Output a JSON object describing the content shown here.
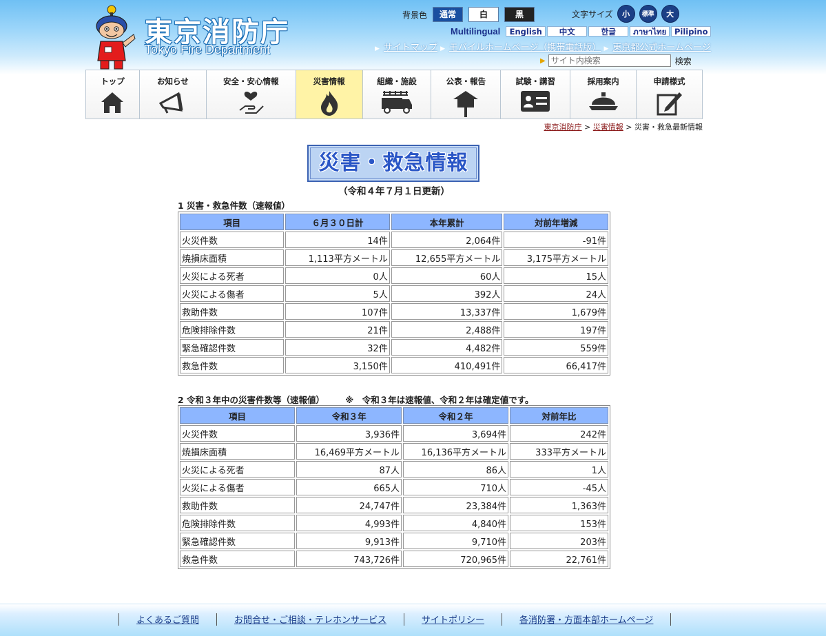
{
  "header": {
    "logo_jp": "東京消防庁",
    "logo_en": "Tokyo Fire Department",
    "bg_label": "背景色",
    "bg_options": [
      "通常",
      "白",
      "黒"
    ],
    "font_label": "文字サイズ",
    "font_options": [
      "小",
      "標準",
      "大"
    ],
    "multilingual_label": "Multilingual",
    "languages": [
      "English",
      "中文",
      "한글",
      "ภาษาไทย",
      "Pilipino"
    ],
    "links": [
      "サイトマップ",
      "モバイルホームページ（携帯電話版）",
      "東京都公式ホームページ"
    ],
    "search_placeholder": "サイト内検索",
    "search_button": "検索"
  },
  "nav": [
    {
      "label": "トップ",
      "icon": "house-icon"
    },
    {
      "label": "お知らせ",
      "icon": "megaphone-icon"
    },
    {
      "label": "安全・安心情報",
      "icon": "heart-hand-icon"
    },
    {
      "label": "災害情報",
      "icon": "flame-icon",
      "active": true
    },
    {
      "label": "組織・施設",
      "icon": "fire-truck-icon"
    },
    {
      "label": "公表・報告",
      "icon": "notice-board-icon"
    },
    {
      "label": "試験・講習",
      "icon": "id-card-icon"
    },
    {
      "label": "採用案内",
      "icon": "helmet-icon"
    },
    {
      "label": "申請様式",
      "icon": "form-edit-icon"
    }
  ],
  "breadcrumb": {
    "home": "東京消防庁",
    "sep": ">",
    "parent": "災害情報",
    "current": "災害・救急最新情報"
  },
  "content": {
    "title": "災害・救急情報",
    "updated": "（令和４年７月１日更新）",
    "section1": {
      "title": "1 災害・救急件数（速報値）",
      "headers": [
        "項目",
        "６月３０日計",
        "本年累計",
        "対前年増減"
      ],
      "rows": [
        [
          "火災件数",
          "14件",
          "2,064件",
          "-91件"
        ],
        [
          "焼損床面積",
          "1,113平方メートル",
          "12,655平方メートル",
          "3,175平方メートル"
        ],
        [
          "火災による死者",
          "0人",
          "60人",
          "15人"
        ],
        [
          "火災による傷者",
          "5人",
          "392人",
          "24人"
        ],
        [
          "救助件数",
          "107件",
          "13,337件",
          "1,679件"
        ],
        [
          "危険排除件数",
          "21件",
          "2,488件",
          "197件"
        ],
        [
          "緊急確認件数",
          "32件",
          "4,482件",
          "559件"
        ],
        [
          "救急件数",
          "3,150件",
          "410,491件",
          "66,417件"
        ]
      ]
    },
    "section2": {
      "title": "2 令和３年中の災害件数等（速報値）",
      "note": "※　令和３年は速報値、令和２年は確定値です。",
      "headers": [
        "項目",
        "令和３年",
        "令和２年",
        "対前年比"
      ],
      "rows": [
        [
          "火災件数",
          "3,936件",
          "3,694件",
          "242件"
        ],
        [
          "焼損床面積",
          "16,469平方メートル",
          "16,136平方メートル",
          "333平方メートル"
        ],
        [
          "火災による死者",
          "87人",
          "86人",
          "1人"
        ],
        [
          "火災による傷者",
          "665人",
          "710人",
          "-45人"
        ],
        [
          "救助件数",
          "24,747件",
          "23,384件",
          "1,363件"
        ],
        [
          "危険排除件数",
          "4,993件",
          "4,840件",
          "153件"
        ],
        [
          "緊急確認件数",
          "9,913件",
          "9,710件",
          "203件"
        ],
        [
          "救急件数",
          "743,726件",
          "720,965件",
          "22,761件"
        ]
      ]
    }
  },
  "footer": {
    "links": [
      "よくあるご質問",
      "お問合せ・ご相談・テレホンサービス",
      "サイトポリシー",
      "各消防署・方面本部ホームページ"
    ]
  }
}
